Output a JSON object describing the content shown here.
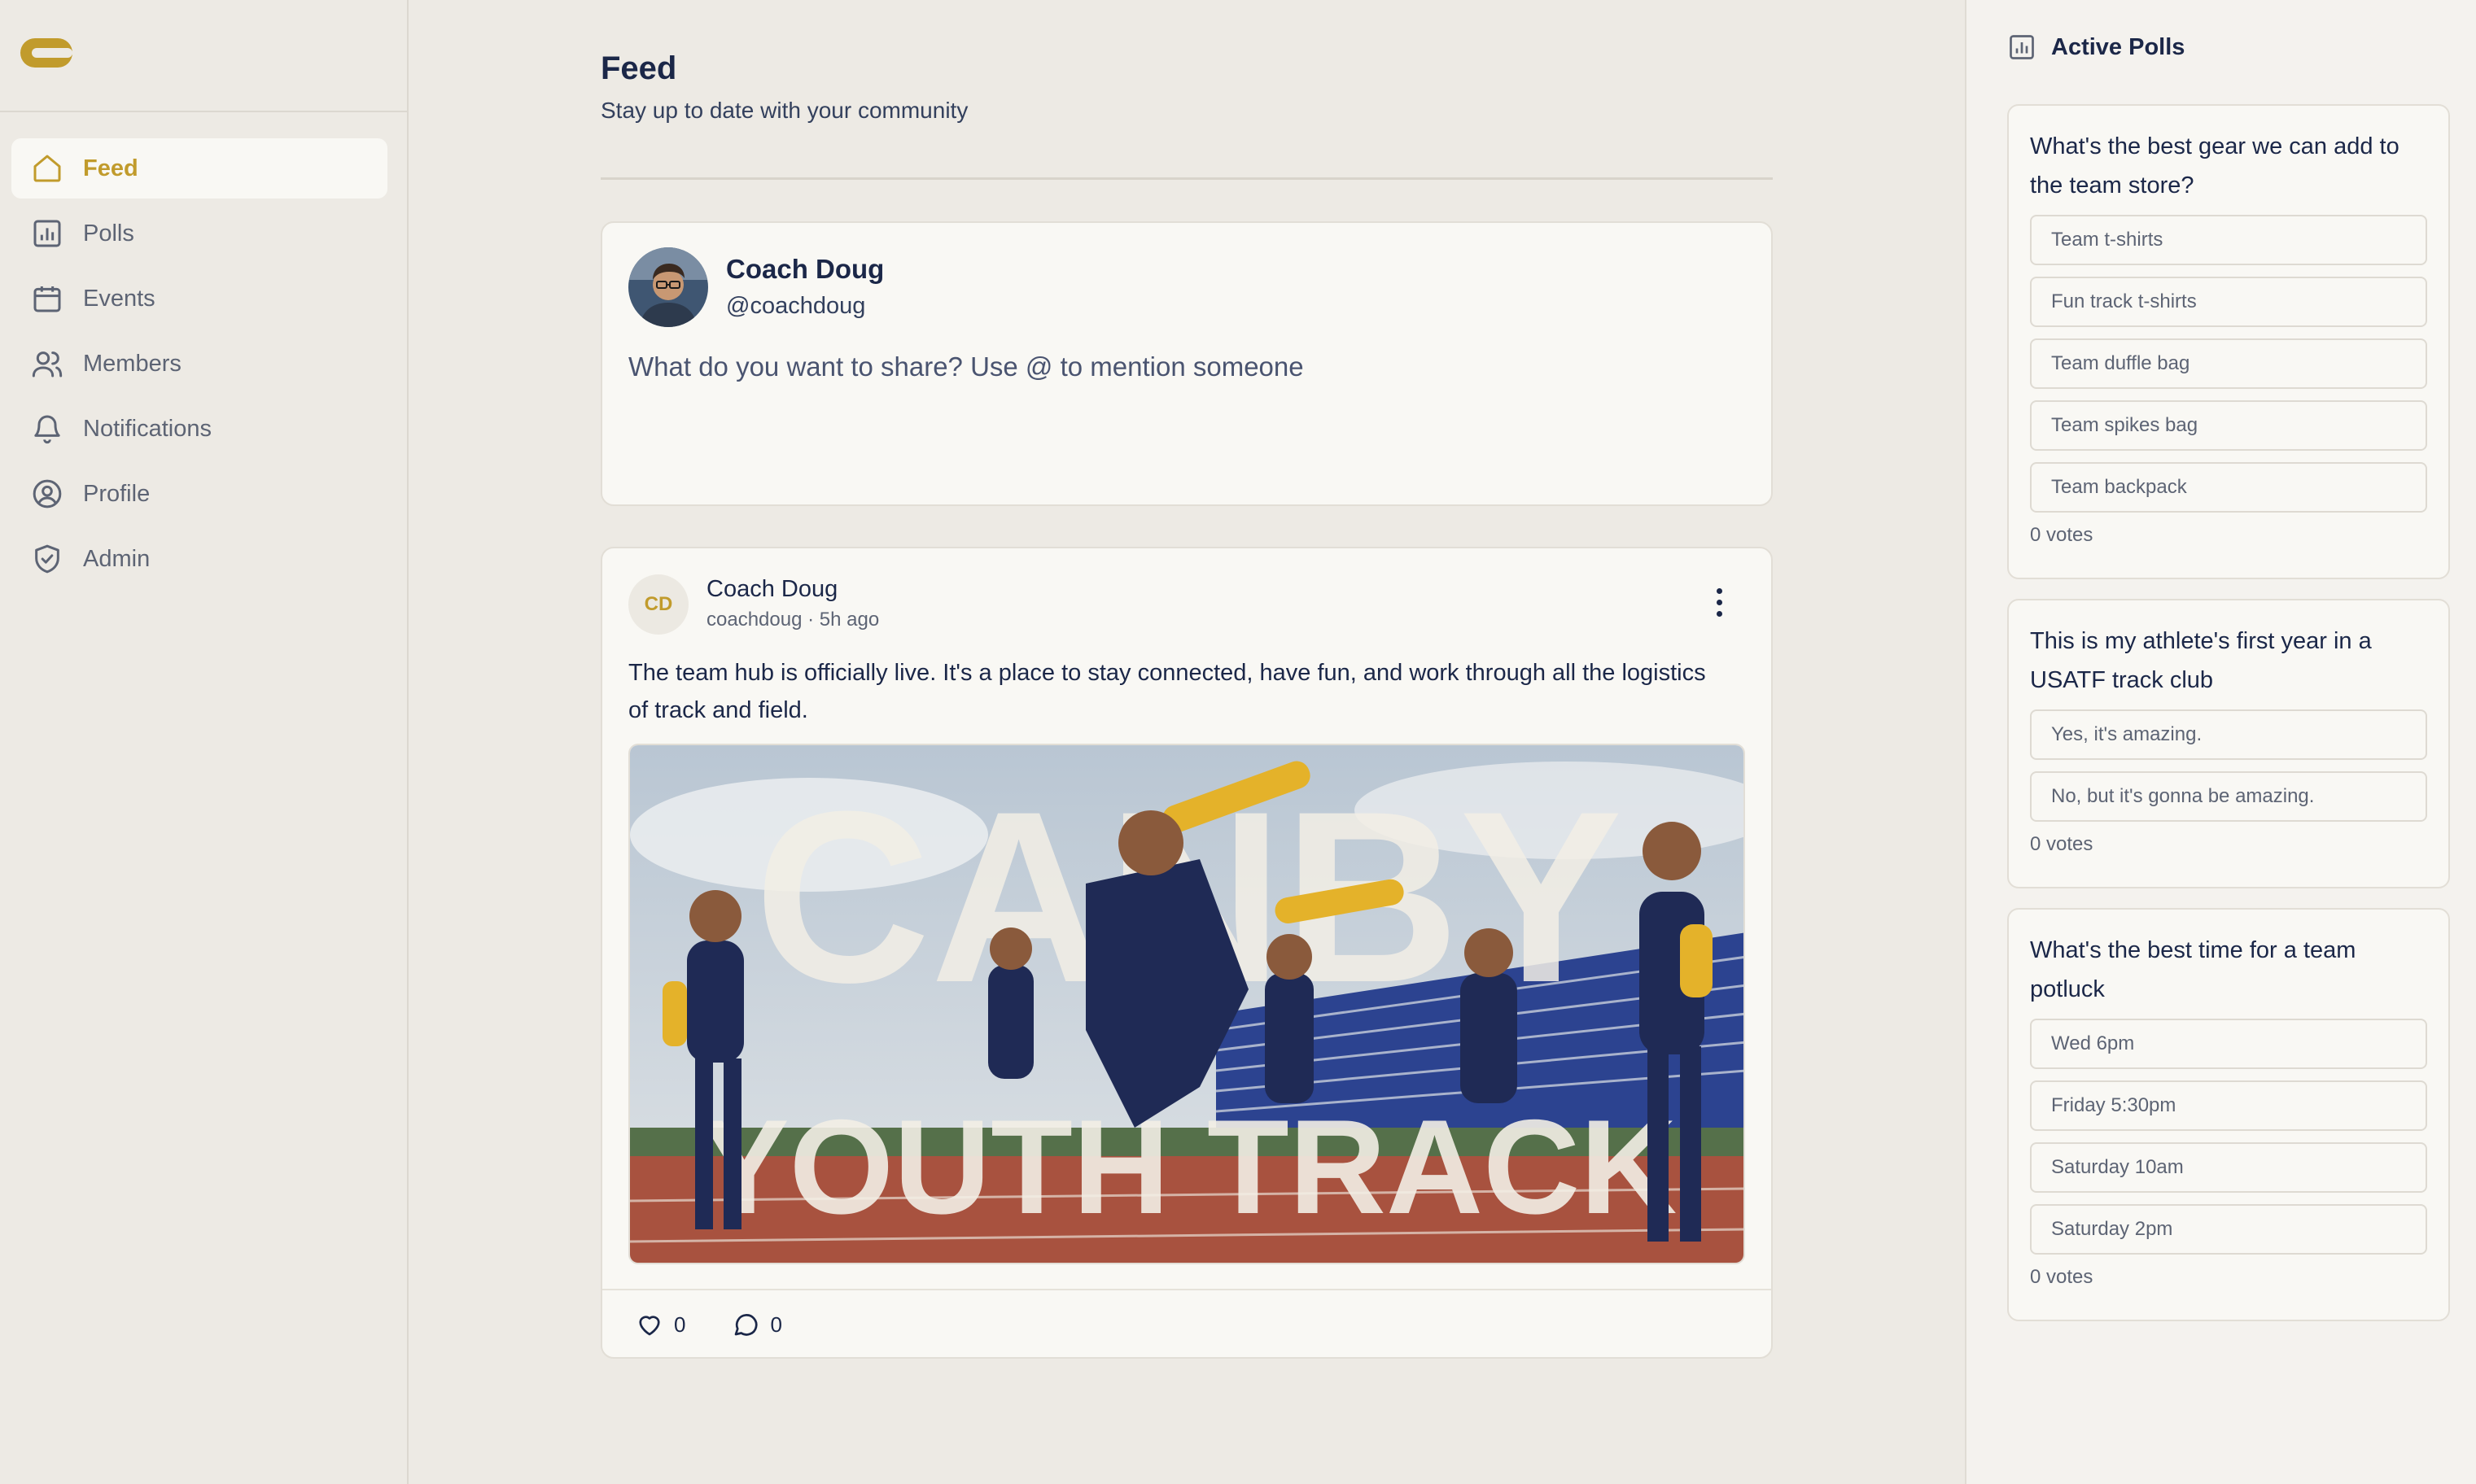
{
  "brand": {
    "accent": "#c19b2c",
    "navy": "#1b2748",
    "logo_icon": "canby-c-logo"
  },
  "nav": {
    "items": [
      {
        "label": "Feed",
        "icon": "home-icon",
        "active": true
      },
      {
        "label": "Polls",
        "icon": "bar-chart-icon"
      },
      {
        "label": "Events",
        "icon": "calendar-icon"
      },
      {
        "label": "Members",
        "icon": "users-icon"
      },
      {
        "label": "Notifications",
        "icon": "bell-icon"
      },
      {
        "label": "Profile",
        "icon": "user-circle-icon"
      },
      {
        "label": "Admin",
        "icon": "shield-check-icon"
      }
    ]
  },
  "page": {
    "title": "Feed",
    "subtitle": "Stay up to date with your community"
  },
  "composer": {
    "name": "Coach Doug",
    "handle": "@coachdoug",
    "placeholder": "What do you want to share? Use @ to mention someone"
  },
  "post": {
    "initials": "CD",
    "author": "Coach Doug",
    "meta": "coachdoug · 5h ago",
    "text": "The team hub is officially live. It's a place to stay connected, have fun, and work through all the logistics of track and field.",
    "image_text_top": "CANBY",
    "image_text_bottom": "YOUTH TRACK",
    "likes": "0",
    "comments": "0"
  },
  "polls": {
    "header": "Active Polls",
    "items": [
      {
        "question": "What's the best gear we can add to the team store?",
        "options": [
          "Team t-shirts",
          "Fun track t-shirts",
          "Team duffle bag",
          "Team spikes bag",
          "Team backpack"
        ],
        "votes": "0 votes"
      },
      {
        "question": "This is my athlete's first year in a USATF track club",
        "options": [
          "Yes, it's amazing.",
          "No, but it's gonna be amazing."
        ],
        "votes": "0 votes"
      },
      {
        "question": "What's the best time for a team potluck",
        "options": [
          "Wed 6pm",
          "Friday 5:30pm",
          "Saturday 10am",
          "Saturday 2pm"
        ],
        "votes": "0 votes"
      }
    ]
  }
}
